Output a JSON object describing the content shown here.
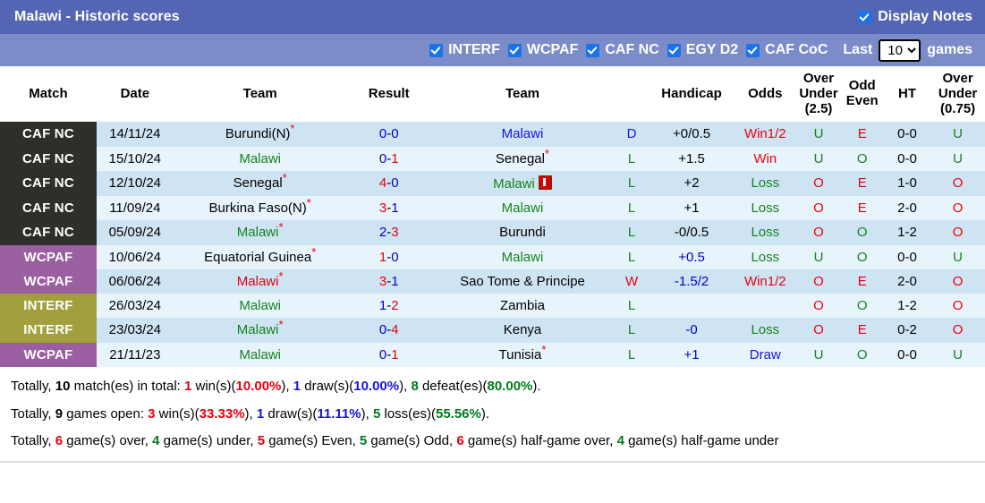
{
  "header": {
    "title": "Malawi - Historic scores",
    "display_notes_label": "Display Notes",
    "display_notes_checked": true,
    "bg_color": "#5466b3"
  },
  "filters": {
    "bg_color": "#7b8cc8",
    "items": [
      {
        "label": "INTERF",
        "checked": true
      },
      {
        "label": "WCPAF",
        "checked": true
      },
      {
        "label": "CAF NC",
        "checked": true
      },
      {
        "label": "EGY D2",
        "checked": true
      },
      {
        "label": "CAF CoC",
        "checked": true
      }
    ],
    "last_label": "Last",
    "games_label": "games",
    "games_value": "10",
    "games_options": [
      "5",
      "10",
      "20",
      "30"
    ]
  },
  "table": {
    "columns": [
      {
        "key": "league",
        "label": "Match"
      },
      {
        "key": "date",
        "label": "Date"
      },
      {
        "key": "team1",
        "label": "Team"
      },
      {
        "key": "result",
        "label": "Result"
      },
      {
        "key": "team2",
        "label": "Team"
      },
      {
        "key": "wl",
        "label": ""
      },
      {
        "key": "handicap",
        "label": "Handicap"
      },
      {
        "key": "odds",
        "label": "Odds"
      },
      {
        "key": "ou25",
        "label": "Over Under (2.5)"
      },
      {
        "key": "oddeven",
        "label": "Odd Even"
      },
      {
        "key": "ht",
        "label": "HT"
      },
      {
        "key": "ou075",
        "label": "Over Under (0.75)"
      }
    ],
    "column_labels": {
      "match": "Match",
      "date": "Date",
      "team_home": "Team",
      "result": "Result",
      "team_away": "Team",
      "handicap": "Handicap",
      "odds": "Odds",
      "ou25_l1": "Over",
      "ou25_l2": "Under",
      "ou25_l3": "(2.5)",
      "oddeven_l1": "Odd",
      "oddeven_l2": "Even",
      "ht": "HT",
      "ou075_l1": "Over",
      "ou075_l2": "Under",
      "ou075_l3": "(0.75)"
    },
    "league_colors": {
      "CAF NC": "#2f2e2b",
      "WCPAF": "#9a5fa0",
      "INTERF": "#a1a03c"
    },
    "rows": [
      {
        "league": "CAF NC",
        "league_class": "lg-cafnc",
        "date": "14/11/24",
        "team1": "Burundi(N)",
        "team1_star": true,
        "team1_color": "c-black",
        "score_home": "0",
        "score_home_color": "c-navy",
        "score_away": "0",
        "score_away_color": "c-navy",
        "team2": "Malawi",
        "team2_star": false,
        "team2_color": "c-blue",
        "team2_redcard": false,
        "wl": "D",
        "wl_color": "c-blue",
        "handicap": "+0/0.5",
        "handicap_color": "c-black",
        "odds": "Win1/2",
        "odds_color": "c-red",
        "ou25": "U",
        "ou25_color": "c-green",
        "oddeven": "E",
        "oddeven_color": "c-red",
        "ht": "0-0",
        "ou075": "U",
        "ou075_color": "c-green"
      },
      {
        "league": "CAF NC",
        "league_class": "lg-cafnc",
        "date": "15/10/24",
        "team1": "Malawi",
        "team1_star": false,
        "team1_color": "c-green",
        "score_home": "0",
        "score_home_color": "c-navy",
        "score_away": "1",
        "score_away_color": "c-red",
        "team2": "Senegal",
        "team2_star": true,
        "team2_color": "c-black",
        "team2_redcard": false,
        "wl": "L",
        "wl_color": "c-green",
        "handicap": "+1.5",
        "handicap_color": "c-black",
        "odds": "Win",
        "odds_color": "c-red",
        "ou25": "U",
        "ou25_color": "c-green",
        "oddeven": "O",
        "oddeven_color": "c-green",
        "ht": "0-0",
        "ou075": "U",
        "ou075_color": "c-green"
      },
      {
        "league": "CAF NC",
        "league_class": "lg-cafnc",
        "date": "12/10/24",
        "team1": "Senegal",
        "team1_star": true,
        "team1_color": "c-black",
        "score_home": "4",
        "score_home_color": "c-red",
        "score_away": "0",
        "score_away_color": "c-navy",
        "team2": "Malawi",
        "team2_star": false,
        "team2_color": "c-green",
        "team2_redcard": true,
        "wl": "L",
        "wl_color": "c-green",
        "handicap": "+2",
        "handicap_color": "c-black",
        "odds": "Loss",
        "odds_color": "c-green",
        "ou25": "O",
        "ou25_color": "c-red",
        "oddeven": "E",
        "oddeven_color": "c-red",
        "ht": "1-0",
        "ou075": "O",
        "ou075_color": "c-red"
      },
      {
        "league": "CAF NC",
        "league_class": "lg-cafnc",
        "date": "11/09/24",
        "team1": "Burkina Faso(N)",
        "team1_star": true,
        "team1_color": "c-black",
        "score_home": "3",
        "score_home_color": "c-red",
        "score_away": "1",
        "score_away_color": "c-navy",
        "team2": "Malawi",
        "team2_star": false,
        "team2_color": "c-green",
        "team2_redcard": false,
        "wl": "L",
        "wl_color": "c-green",
        "handicap": "+1",
        "handicap_color": "c-black",
        "odds": "Loss",
        "odds_color": "c-green",
        "ou25": "O",
        "ou25_color": "c-red",
        "oddeven": "E",
        "oddeven_color": "c-red",
        "ht": "2-0",
        "ou075": "O",
        "ou075_color": "c-red"
      },
      {
        "league": "CAF NC",
        "league_class": "lg-cafnc",
        "date": "05/09/24",
        "team1": "Malawi",
        "team1_star": true,
        "team1_color": "c-green",
        "score_home": "2",
        "score_home_color": "c-navy",
        "score_away": "3",
        "score_away_color": "c-red",
        "team2": "Burundi",
        "team2_star": false,
        "team2_color": "c-black",
        "team2_redcard": false,
        "wl": "L",
        "wl_color": "c-green",
        "handicap": "-0/0.5",
        "handicap_color": "c-black",
        "odds": "Loss",
        "odds_color": "c-green",
        "ou25": "O",
        "ou25_color": "c-red",
        "oddeven": "O",
        "oddeven_color": "c-green",
        "ht": "1-2",
        "ou075": "O",
        "ou075_color": "c-red"
      },
      {
        "league": "WCPAF",
        "league_class": "lg-wcpaf",
        "date": "10/06/24",
        "team1": "Equatorial Guinea",
        "team1_star": true,
        "team1_color": "c-black",
        "score_home": "1",
        "score_home_color": "c-red",
        "score_away": "0",
        "score_away_color": "c-navy",
        "team2": "Malawi",
        "team2_star": false,
        "team2_color": "c-green",
        "team2_redcard": false,
        "wl": "L",
        "wl_color": "c-green",
        "handicap": "+0.5",
        "handicap_color": "c-navy",
        "odds": "Loss",
        "odds_color": "c-green",
        "ou25": "U",
        "ou25_color": "c-green",
        "oddeven": "O",
        "oddeven_color": "c-green",
        "ht": "0-0",
        "ou075": "U",
        "ou075_color": "c-green"
      },
      {
        "league": "WCPAF",
        "league_class": "lg-wcpaf",
        "date": "06/06/24",
        "team1": "Malawi",
        "team1_star": true,
        "team1_color": "c-red",
        "score_home": "3",
        "score_home_color": "c-red",
        "score_away": "1",
        "score_away_color": "c-navy",
        "team2": "Sao Tome & Principe",
        "team2_star": false,
        "team2_color": "c-black",
        "team2_redcard": false,
        "wl": "W",
        "wl_color": "c-red",
        "handicap": "-1.5/2",
        "handicap_color": "c-navy",
        "odds": "Win1/2",
        "odds_color": "c-red",
        "ou25": "O",
        "ou25_color": "c-red",
        "oddeven": "E",
        "oddeven_color": "c-red",
        "ht": "2-0",
        "ou075": "O",
        "ou075_color": "c-red"
      },
      {
        "league": "INTERF",
        "league_class": "lg-interf",
        "date": "26/03/24",
        "team1": "Malawi",
        "team1_star": false,
        "team1_color": "c-green",
        "score_home": "1",
        "score_home_color": "c-navy",
        "score_away": "2",
        "score_away_color": "c-red",
        "team2": "Zambia",
        "team2_star": false,
        "team2_color": "c-black",
        "team2_redcard": false,
        "wl": "L",
        "wl_color": "c-green",
        "handicap": "",
        "handicap_color": "c-black",
        "odds": "",
        "odds_color": "c-green",
        "ou25": "O",
        "ou25_color": "c-red",
        "oddeven": "O",
        "oddeven_color": "c-green",
        "ht": "1-2",
        "ou075": "O",
        "ou075_color": "c-red"
      },
      {
        "league": "INTERF",
        "league_class": "lg-interf",
        "date": "23/03/24",
        "team1": "Malawi",
        "team1_star": true,
        "team1_color": "c-green",
        "score_home": "0",
        "score_home_color": "c-navy",
        "score_away": "4",
        "score_away_color": "c-red",
        "team2": "Kenya",
        "team2_star": false,
        "team2_color": "c-black",
        "team2_redcard": false,
        "wl": "L",
        "wl_color": "c-green",
        "handicap": "-0",
        "handicap_color": "c-navy",
        "odds": "Loss",
        "odds_color": "c-green",
        "ou25": "O",
        "ou25_color": "c-red",
        "oddeven": "E",
        "oddeven_color": "c-red",
        "ht": "0-2",
        "ou075": "O",
        "ou075_color": "c-red"
      },
      {
        "league": "WCPAF",
        "league_class": "lg-wcpaf",
        "date": "21/11/23",
        "team1": "Malawi",
        "team1_star": false,
        "team1_color": "c-green",
        "score_home": "0",
        "score_home_color": "c-navy",
        "score_away": "1",
        "score_away_color": "c-red",
        "team2": "Tunisia",
        "team2_star": true,
        "team2_color": "c-black",
        "team2_redcard": false,
        "wl": "L",
        "wl_color": "c-green",
        "handicap": "+1",
        "handicap_color": "c-navy",
        "odds": "Draw",
        "odds_color": "c-blue",
        "ou25": "U",
        "ou25_color": "c-green",
        "oddeven": "O",
        "oddeven_color": "c-green",
        "ht": "0-0",
        "ou075": "U",
        "ou075_color": "c-green"
      }
    ]
  },
  "summary": {
    "line1": {
      "t0": "Totally, ",
      "n_total": "10",
      "t1": " match(es) in total: ",
      "n_wins": "1",
      "t2": " win(s)(",
      "p_wins": "10.00%",
      "t3": "), ",
      "n_draws": "1",
      "t4": " draw(s)(",
      "p_draws": "10.00%",
      "t5": "), ",
      "n_defeats": "8",
      "t6": " defeat(es)(",
      "p_defeats": "80.00%",
      "t7": ")."
    },
    "line2": {
      "t0": "Totally, ",
      "n_open": "9",
      "t1": " games open: ",
      "n_wins": "3",
      "t2": " win(s)(",
      "p_wins": "33.33%",
      "t3": "), ",
      "n_draws": "1",
      "t4": " draw(s)(",
      "p_draws": "11.11%",
      "t5": "), ",
      "n_loss": "5",
      "t6": " loss(es)(",
      "p_loss": "55.56%",
      "t7": ")."
    },
    "line3": {
      "t0": "Totally, ",
      "n_over": "6",
      "t1": " game(s) over, ",
      "n_under": "4",
      "t2": " game(s) under, ",
      "n_even": "5",
      "t3": " game(s) Even, ",
      "n_odd": "5",
      "t4": " game(s) Odd, ",
      "n_half_over": "6",
      "t5": " game(s) half-game over, ",
      "n_half_under": "4",
      "t6": " game(s) half-game under"
    }
  }
}
